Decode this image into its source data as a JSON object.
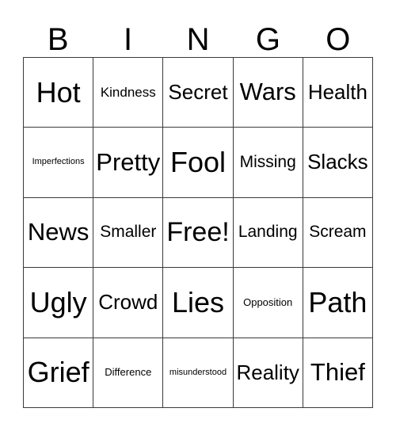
{
  "card": {
    "type": "bingo-card",
    "header_letters": [
      "B",
      "I",
      "N",
      "G",
      "O"
    ],
    "columns": 5,
    "rows": 5,
    "free_space": "Free!",
    "free_space_position": {
      "row": 3,
      "column": 3
    },
    "colors": {
      "background": "#ffffff",
      "text": "#000000",
      "grid_line": "#3a3a3a"
    },
    "grid": [
      [
        {
          "text": "Hot",
          "size": "fs-xxl"
        },
        {
          "text": "Kindness",
          "size": "fs-s"
        },
        {
          "text": "Secret",
          "size": "fs-l"
        },
        {
          "text": "Wars",
          "size": "fs-xl"
        },
        {
          "text": "Health",
          "size": "fs-l"
        }
      ],
      [
        {
          "text": "Imperfections",
          "size": "fs-xxs"
        },
        {
          "text": "Pretty",
          "size": "fs-xl"
        },
        {
          "text": "Fool",
          "size": "fs-xxl"
        },
        {
          "text": "Missing",
          "size": "fs-m"
        },
        {
          "text": "Slacks",
          "size": "fs-l"
        }
      ],
      [
        {
          "text": "News",
          "size": "fs-xl"
        },
        {
          "text": "Smaller",
          "size": "fs-m"
        },
        {
          "text": "Free!",
          "size": "fs-xxl"
        },
        {
          "text": "Landing",
          "size": "fs-m"
        },
        {
          "text": "Scream",
          "size": "fs-m"
        }
      ],
      [
        {
          "text": "Ugly",
          "size": "fs-xxl"
        },
        {
          "text": "Crowd",
          "size": "fs-l"
        },
        {
          "text": "Lies",
          "size": "fs-xxl"
        },
        {
          "text": "Opposition",
          "size": "fs-xs"
        },
        {
          "text": "Path",
          "size": "fs-xxl"
        }
      ],
      [
        {
          "text": "Grief",
          "size": "fs-xxl"
        },
        {
          "text": "Difference",
          "size": "fs-xs"
        },
        {
          "text": "misunderstood",
          "size": "fs-xxs"
        },
        {
          "text": "Reality",
          "size": "fs-l"
        },
        {
          "text": "Thief",
          "size": "fs-xl"
        }
      ]
    ]
  }
}
